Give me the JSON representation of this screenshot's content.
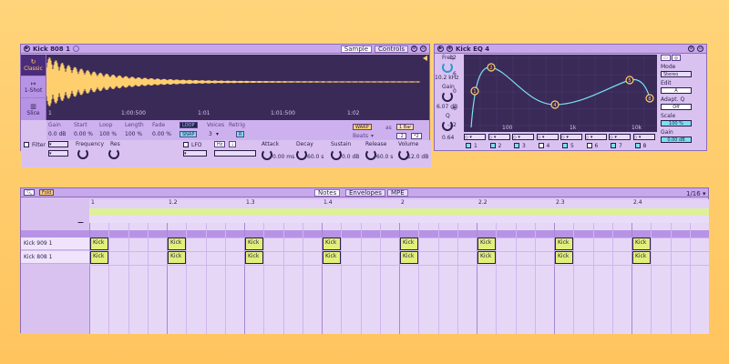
{
  "simpler": {
    "title": "Kick 808 1",
    "tabs": [
      "Sample",
      "Controls"
    ],
    "modes": [
      "Classic",
      "1-Shot",
      "Slice"
    ],
    "ruler": [
      "1",
      "1:00:500",
      "1:01",
      "1:01:500",
      "1:02"
    ],
    "params": {
      "gain": {
        "label": "Gain",
        "value": "0.0 dB"
      },
      "start": {
        "label": "Start",
        "value": "0.00 %"
      },
      "loop": {
        "label": "Loop",
        "value": "100 %"
      },
      "length": {
        "label": "Length",
        "value": "100 %"
      },
      "fade": {
        "label": "Fade",
        "value": "0.00 %"
      },
      "loop_btn": "LOOP",
      "snap_btn": "SNAP",
      "voices": {
        "label": "Voices",
        "value": "3"
      },
      "retrig": {
        "label": "Retrig",
        "value": "R"
      },
      "warp_btn": "WARP",
      "as_label": "as",
      "bars_value": "1 Bar",
      "beats_label": "Beats",
      "div2": ":2",
      "mul2": "*2"
    },
    "filter": {
      "label": "Filter",
      "frequency": "Frequency",
      "res": "Res"
    },
    "lfo": {
      "label": "LFO",
      "hz": "Hz",
      "note": "♩"
    },
    "envelope": {
      "attack": {
        "label": "Attack",
        "value": "0.00 ms"
      },
      "decay": {
        "label": "Decay",
        "value": "60.0 s"
      },
      "sustain": {
        "label": "Sustain",
        "value": "0.0 dB"
      },
      "release": {
        "label": "Release",
        "value": "60.0 s"
      },
      "volume": {
        "label": "Volume",
        "value": "-12.0 dB"
      }
    }
  },
  "eq": {
    "title": "Kick EQ 4",
    "freq": {
      "label": "Freq",
      "value": "10.2 kHz"
    },
    "gain": {
      "label": "Gain",
      "value": "6.07 dB"
    },
    "q": {
      "label": "Q",
      "value": "0.64"
    },
    "y_ticks": [
      "12",
      "6",
      "0",
      "-6",
      "-12"
    ],
    "x_ticks": [
      "100",
      "1k",
      "10k"
    ],
    "bands": [
      "1",
      "2",
      "3",
      "4",
      "5",
      "6",
      "7",
      "8"
    ],
    "mode_label": "Mode",
    "mode_value": "Stereo",
    "edit_label": "Edit",
    "edit_value": "A",
    "adapt_label": "Adapt. Q",
    "adapt_value": "Off",
    "scale_label": "Scale",
    "scale_value": "100 %",
    "gain2_label": "Gain",
    "gain2_value": "0.00 dB",
    "points": [
      {
        "id": "1",
        "color": "#ffcf6e"
      },
      {
        "id": "2",
        "color": "#ffcf6e"
      },
      {
        "id": "4",
        "color": "#ffcf6e"
      },
      {
        "id": "5",
        "color": "#ffcf6e"
      },
      {
        "id": "8",
        "color": "#ffcf6e"
      }
    ]
  },
  "clip": {
    "fold_label": "Fold",
    "tabs": [
      "Notes",
      "Envelopes",
      "MPE"
    ],
    "grid": "1/16 ▾",
    "ruler": [
      "1",
      "1.2",
      "1.3",
      "1.4",
      "2",
      "2.2",
      "2.3",
      "2.4"
    ],
    "lanes": [
      {
        "name": "Kick 909 1"
      },
      {
        "name": "Kick 808 1"
      }
    ],
    "note_label": "Kick"
  },
  "colors": {
    "accent": "#ffcf6e",
    "panel": "#d9c2f0",
    "display": "#3a2a58",
    "note": "#e1f07a",
    "curve": "#7ae0f0"
  }
}
